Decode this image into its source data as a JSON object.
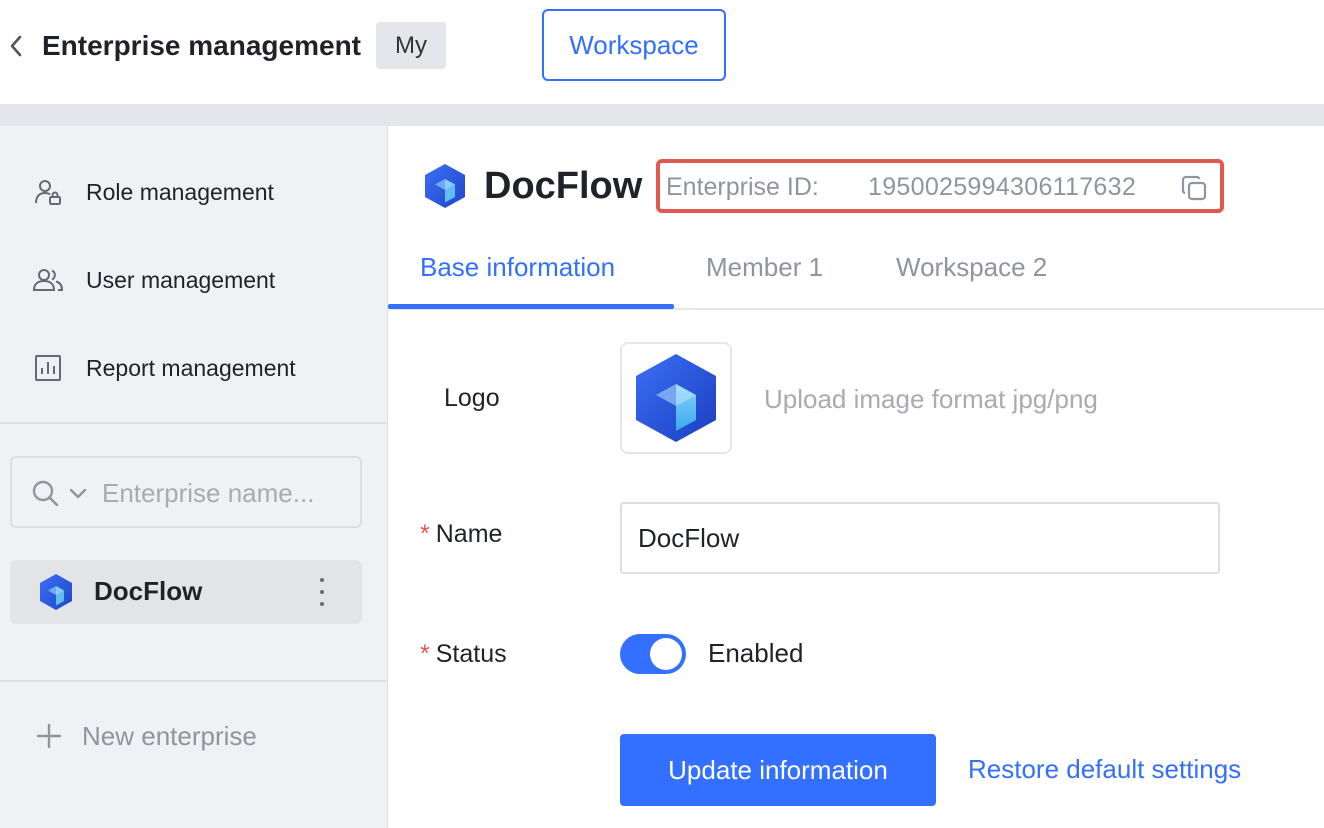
{
  "header": {
    "title": "Enterprise management",
    "tabs": [
      "My",
      "Workspace"
    ],
    "active_tab": "Workspace"
  },
  "sidebar": {
    "nav": [
      {
        "label": "Role management",
        "icon": "role-icon"
      },
      {
        "label": "User management",
        "icon": "users-icon"
      },
      {
        "label": "Report management",
        "icon": "report-icon"
      }
    ],
    "search": {
      "placeholder": "Enterprise name..."
    },
    "enterprises": [
      {
        "name": "DocFlow"
      }
    ],
    "new_enterprise_label": "New enterprise"
  },
  "main": {
    "enterprise_name": "DocFlow",
    "enterprise_id_label": "Enterprise ID:",
    "enterprise_id": "1950025994306117632",
    "tabs": [
      {
        "label": "Base information"
      },
      {
        "label": "Member 1"
      },
      {
        "label": "Workspace 2"
      }
    ],
    "active_tab": "Base information",
    "form": {
      "logo_label": "Logo",
      "upload_hint": "Upload image format jpg/png",
      "name_label": "Name",
      "name_value": "DocFlow",
      "status_label": "Status",
      "status_value": "Enabled",
      "status_on": true,
      "required_mark": "*"
    },
    "actions": {
      "update_label": "Update information",
      "restore_label": "Restore default settings"
    }
  },
  "colors": {
    "accent": "#3370ff",
    "highlight_border": "#e0584f",
    "sidebar_bg": "#f0f1f4"
  }
}
